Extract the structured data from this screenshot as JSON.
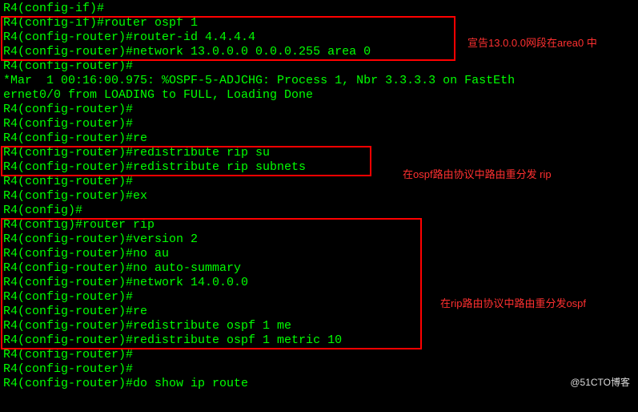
{
  "lines": {
    "l00": "R4(config-if)#",
    "l01": "R4(config-if)#router ospf 1",
    "l02": "R4(config-router)#router-id 4.4.4.4",
    "l03": "R4(config-router)#network 13.0.0.0 0.0.0.255 area 0",
    "l04": "R4(config-router)#",
    "l05": "*Mar  1 00:16:00.975: %OSPF-5-ADJCHG: Process 1, Nbr 3.3.3.3 on FastEth",
    "l06": "ernet0/0 from LOADING to FULL, Loading Done",
    "l07": "R4(config-router)#",
    "l08": "R4(config-router)#",
    "l09": "R4(config-router)#re",
    "l10": "R4(config-router)#redistribute rip su",
    "l11": "R4(config-router)#redistribute rip subnets",
    "l12": "R4(config-router)#",
    "l13": "R4(config-router)#ex",
    "l14": "R4(config)#",
    "l15": "R4(config)#router rip",
    "l16": "R4(config-router)#version 2",
    "l17": "R4(config-router)#no au",
    "l18": "R4(config-router)#no auto-summary",
    "l19": "R4(config-router)#network 14.0.0.0",
    "l20": "R4(config-router)#",
    "l21": "R4(config-router)#re",
    "l22": "R4(config-router)#redistribute ospf 1 me",
    "l23": "R4(config-router)#redistribute ospf 1 metric 10",
    "l24": "R4(config-router)#",
    "l25": "R4(config-router)#",
    "l26": "R4(config-router)#do show ip route"
  },
  "annotations": {
    "a1": "宣告13.0.0.0网段在area0 中",
    "a2": "在ospf路由协议中路由重分发 rip",
    "a3": "在rip路由协议中路由重分发ospf"
  },
  "watermark": "@51CTO博客"
}
